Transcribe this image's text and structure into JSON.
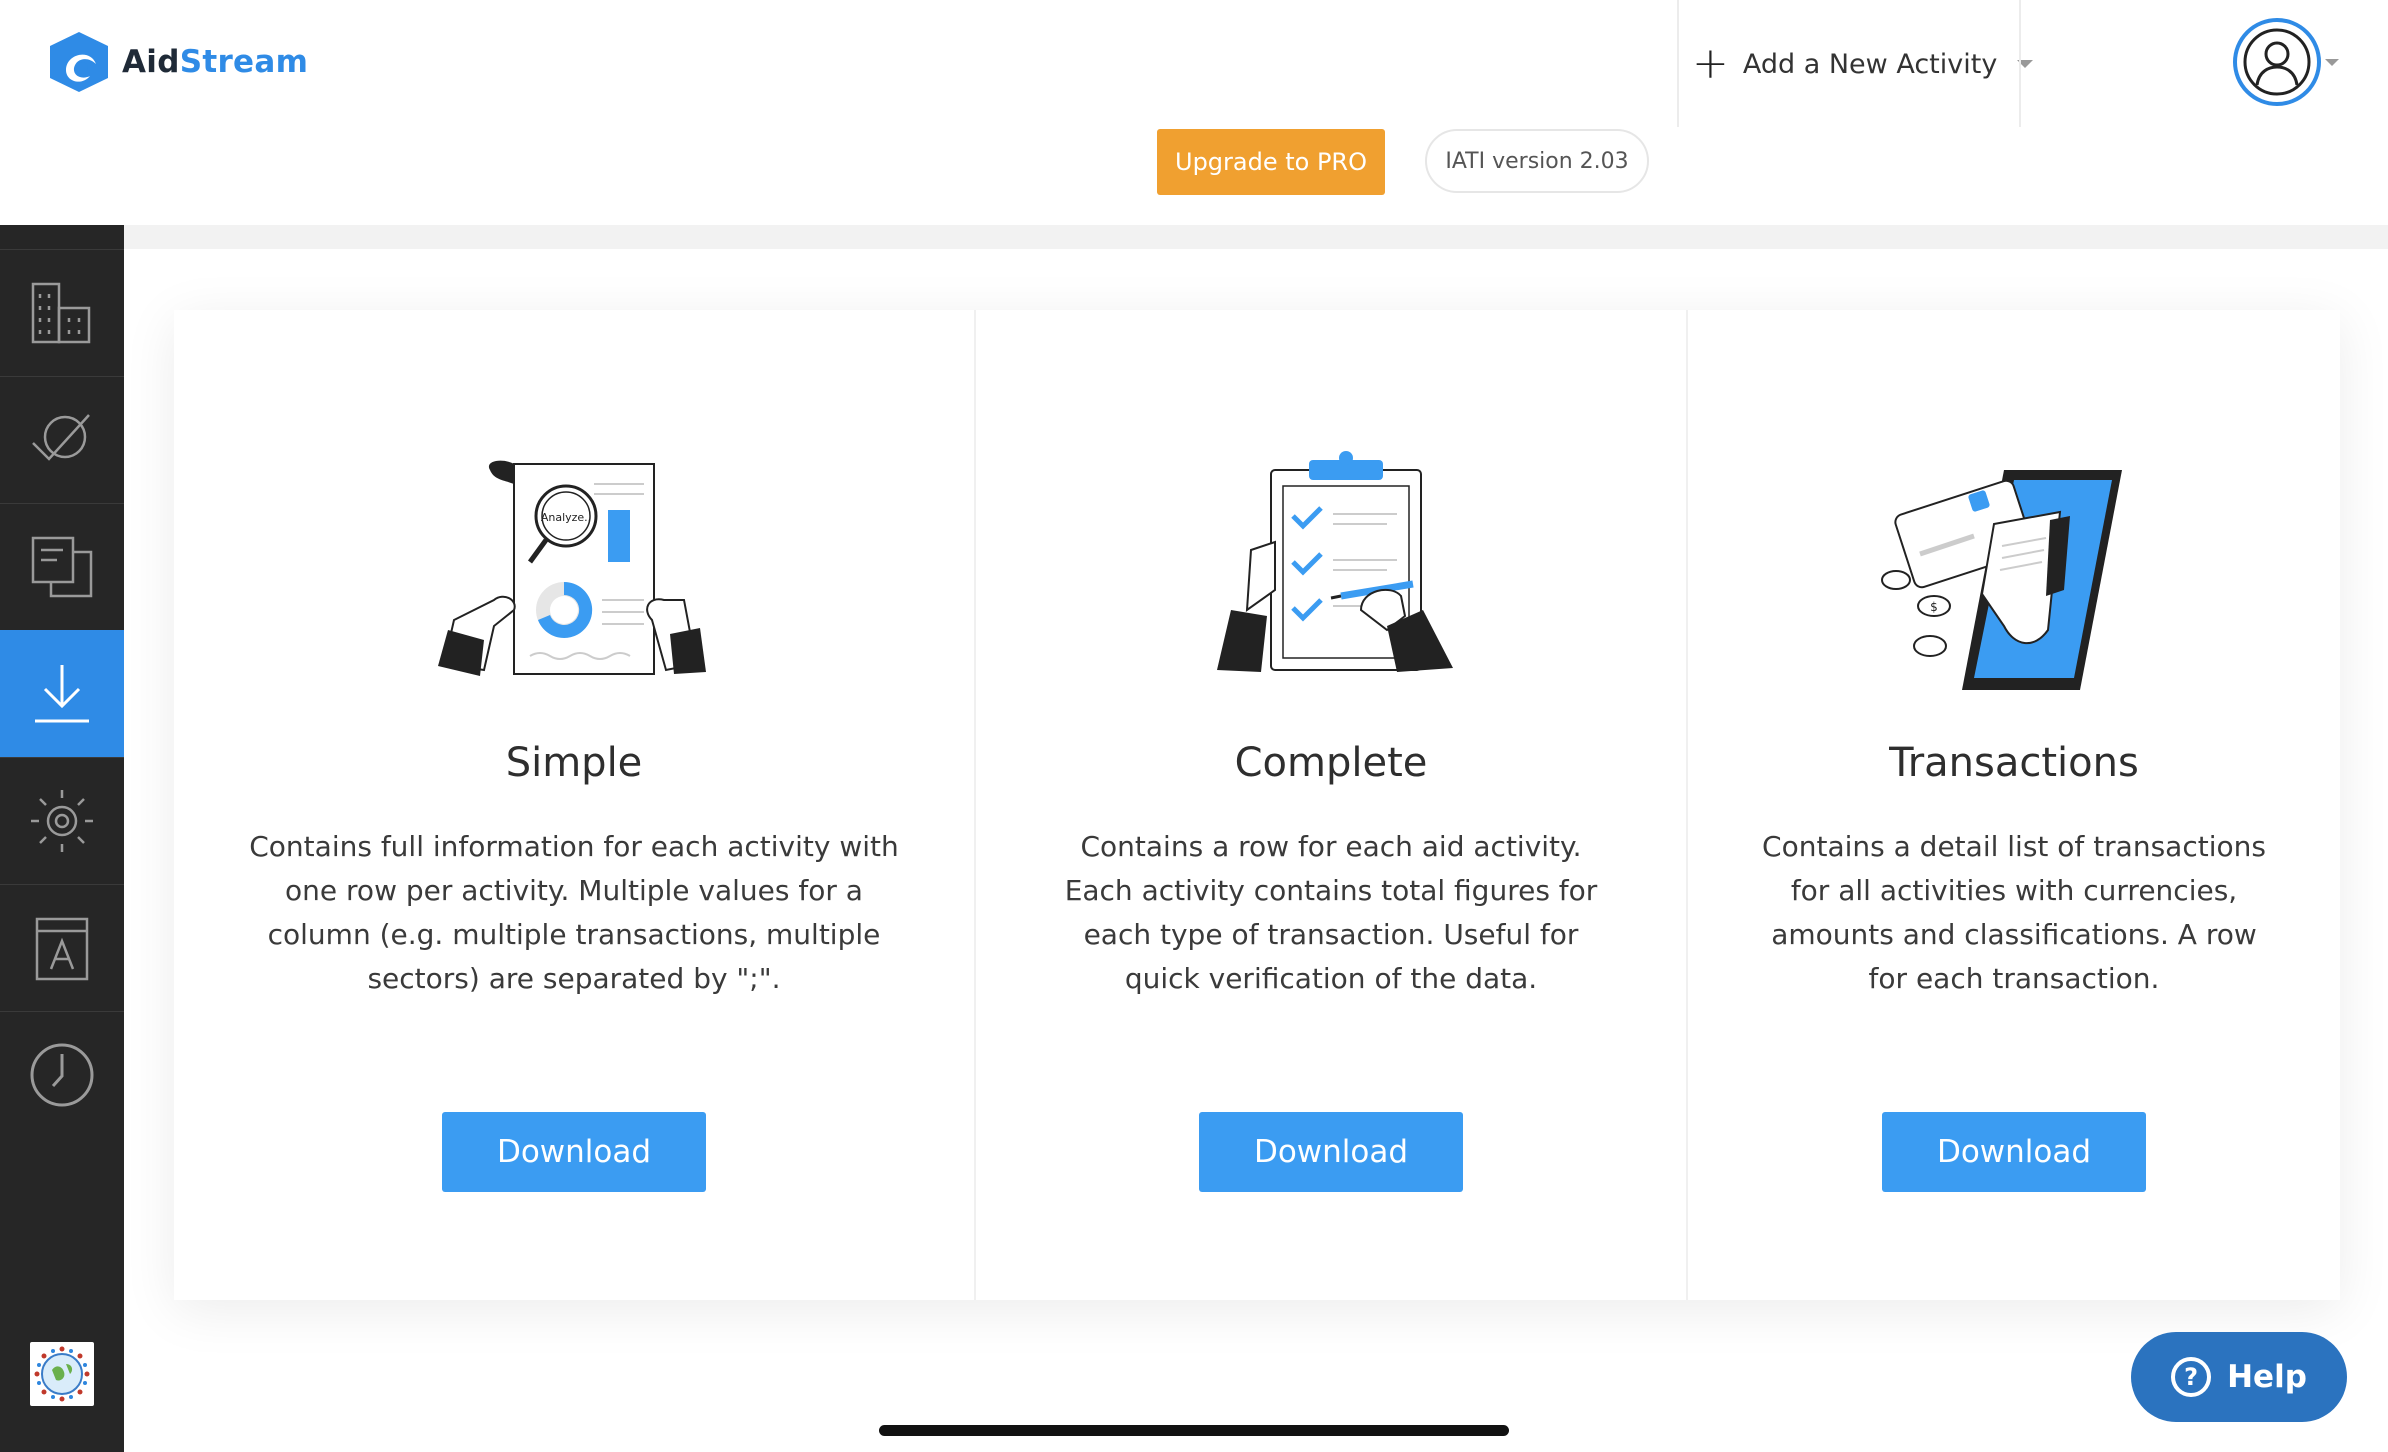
{
  "header": {
    "logo_part1": "Aid",
    "logo_part2": "Stream",
    "add_activity_label": "Add a New Activity",
    "upgrade_label": "Upgrade to PRO",
    "version_label": "IATI version 2.03"
  },
  "sidebar": {
    "items": [
      {
        "icon": "building-icon",
        "active": false
      },
      {
        "icon": "check-circle-icon",
        "active": false
      },
      {
        "icon": "documents-icon",
        "active": false
      },
      {
        "icon": "download-icon",
        "active": true
      },
      {
        "icon": "settings-icon",
        "active": false
      },
      {
        "icon": "document-a-icon",
        "active": false
      },
      {
        "icon": "clock-icon",
        "active": false
      }
    ]
  },
  "cards": [
    {
      "title": "Simple",
      "description": "Contains full information for each activity with one row per activity. Multiple values for a column (e.g. multiple transactions, multiple sectors) are separated by \";\".",
      "illustration_text": "Analyze..",
      "button": "Download"
    },
    {
      "title": "Complete",
      "description": "Contains a row for each aid activity. Each activity contains total figures for each type of transaction. Useful for quick verification of the data.",
      "button": "Download"
    },
    {
      "title": "Transactions",
      "description": "Contains a detail list of transactions for all activities with currencies, amounts and classifications. A row for each transaction.",
      "button": "Download"
    }
  ],
  "help": {
    "label": "Help"
  },
  "colors": {
    "accent": "#2f8be6",
    "button_blue": "#3b9cf2",
    "upgrade_orange": "#f0a030",
    "sidebar_bg": "#262626",
    "help_bg": "#2b73bf"
  }
}
